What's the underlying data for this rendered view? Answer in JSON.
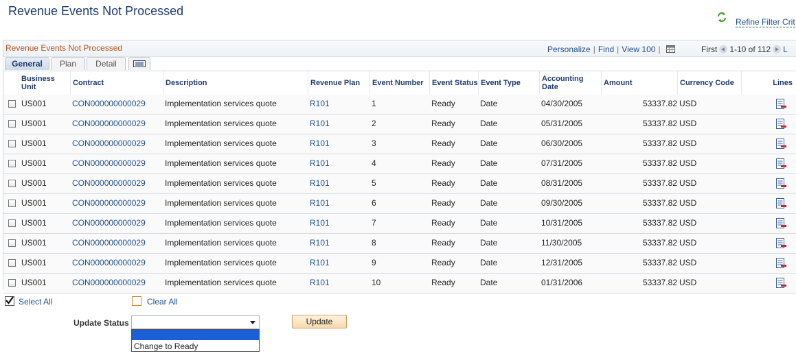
{
  "page": {
    "title": "Revenue Events Not Processed",
    "refine_link": "Refine Filter Crit"
  },
  "grid": {
    "title": "Revenue Events Not Processed",
    "nav": {
      "personalize": "Personalize",
      "find": "Find",
      "view": "View 100",
      "first": "First",
      "range": "1-10 of 112",
      "last": "L"
    },
    "tabs": [
      {
        "label": "General",
        "active": true
      },
      {
        "label": "Plan",
        "active": false
      },
      {
        "label": "Detail",
        "active": false
      }
    ],
    "columns": [
      "Business Unit",
      "Contract",
      "Description",
      "Revenue Plan",
      "Event Number",
      "Event Status",
      "Event Type",
      "Accounting Date",
      "Amount",
      "Currency Code",
      "Lines"
    ],
    "rows": [
      {
        "unit": "US001",
        "contract": "CON000000000029",
        "description": "Implementation services quote",
        "plan": "R101",
        "event": "1",
        "status": "Ready",
        "type": "Date",
        "date": "04/30/2005",
        "amount": "53337.82",
        "currency": "USD"
      },
      {
        "unit": "US001",
        "contract": "CON000000000029",
        "description": "Implementation services quote",
        "plan": "R101",
        "event": "2",
        "status": "Ready",
        "type": "Date",
        "date": "05/31/2005",
        "amount": "53337.82",
        "currency": "USD"
      },
      {
        "unit": "US001",
        "contract": "CON000000000029",
        "description": "Implementation services quote",
        "plan": "R101",
        "event": "3",
        "status": "Ready",
        "type": "Date",
        "date": "06/30/2005",
        "amount": "53337.82",
        "currency": "USD"
      },
      {
        "unit": "US001",
        "contract": "CON000000000029",
        "description": "Implementation services quote",
        "plan": "R101",
        "event": "4",
        "status": "Ready",
        "type": "Date",
        "date": "07/31/2005",
        "amount": "53337.82",
        "currency": "USD"
      },
      {
        "unit": "US001",
        "contract": "CON000000000029",
        "description": "Implementation services quote",
        "plan": "R101",
        "event": "5",
        "status": "Ready",
        "type": "Date",
        "date": "08/31/2005",
        "amount": "53337.82",
        "currency": "USD"
      },
      {
        "unit": "US001",
        "contract": "CON000000000029",
        "description": "Implementation services quote",
        "plan": "R101",
        "event": "6",
        "status": "Ready",
        "type": "Date",
        "date": "09/30/2005",
        "amount": "53337.82",
        "currency": "USD"
      },
      {
        "unit": "US001",
        "contract": "CON000000000029",
        "description": "Implementation services quote",
        "plan": "R101",
        "event": "7",
        "status": "Ready",
        "type": "Date",
        "date": "10/31/2005",
        "amount": "53337.82",
        "currency": "USD"
      },
      {
        "unit": "US001",
        "contract": "CON000000000029",
        "description": "Implementation services quote",
        "plan": "R101",
        "event": "8",
        "status": "Ready",
        "type": "Date",
        "date": "11/30/2005",
        "amount": "53337.82",
        "currency": "USD"
      },
      {
        "unit": "US001",
        "contract": "CON000000000029",
        "description": "Implementation services quote",
        "plan": "R101",
        "event": "9",
        "status": "Ready",
        "type": "Date",
        "date": "12/31/2005",
        "amount": "53337.82",
        "currency": "USD"
      },
      {
        "unit": "US001",
        "contract": "CON000000000029",
        "description": "Implementation services quote",
        "plan": "R101",
        "event": "10",
        "status": "Ready",
        "type": "Date",
        "date": "01/31/2006",
        "amount": "53337.82",
        "currency": "USD"
      }
    ]
  },
  "actions": {
    "select_all": "Select All",
    "clear_all": "Clear All",
    "update_status_label": "Update Status",
    "status_value": "",
    "dropdown_options": [
      "",
      "Change to Ready"
    ],
    "update_button": "Update"
  },
  "colors": {
    "link": "#1f4f91",
    "grid_title": "#b3541e",
    "selected_option": "#1a5fd6"
  }
}
